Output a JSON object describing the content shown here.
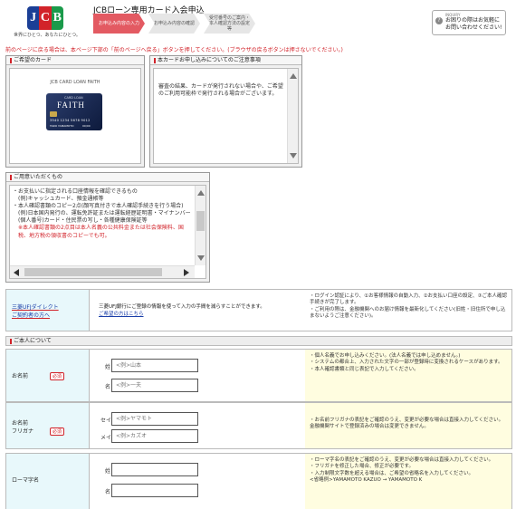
{
  "header": {
    "logo_letters": [
      "J",
      "C",
      "B"
    ],
    "tagline": "世界にひとつ、あなたにひとつ。",
    "title": "JCBローン専用カード入会申込",
    "steps": [
      {
        "label": "お申込み内容の入力",
        "active": true
      },
      {
        "label": "お申込み内容の確認",
        "active": false
      },
      {
        "label": "受付番号のご案内・本人確認方法の設定等",
        "active": false
      }
    ],
    "inquiry": {
      "small": "INQUIRY",
      "text": "お困りの際はお気軽にお問い合わせください!"
    }
  },
  "notice": "前のページに戻る場合は、本ページ下部の「前のページへ戻る」ボタンを押してください。(ブラウザの戻るボタンは押さないでください。)",
  "card_panel": {
    "title": "ご希望のカード",
    "card_name": "JCB CARD LOAN FAITH",
    "card_face": {
      "top": "CARD LOAN",
      "brand": "FAITH",
      "number": "3540 1234 5678 9012",
      "holder": "TARO YAMAMOTO",
      "expiry": "00/00"
    }
  },
  "notes_panel": {
    "title": "本カードお申し込みについてのご注意事項",
    "text": "審査の結果、カードが発行されない場合や、ご希望のご利用可能枠で発行される場合がございます。"
  },
  "prepare_panel": {
    "title": "ご用意いただくもの",
    "items": [
      "・お支払いに指定される口座情報を確認できるもの",
      "(例)キャッシュカード、預金通帳等",
      "・本人確認書類のコピー2点(顔写真付きで本人確認手続きを行う場合)",
      "(例)日本国内発行の、運転免許証または運転経歴証明書・マイナンバー(個人番号)カード・住民票の写し・各種健康保険証等"
    ],
    "red_note": "※本人確認書類の2点目は本人名義の公共料金または社会保険料、国税、地方税の領収書のコピーでも可。"
  },
  "direct_row": {
    "label_line1": "三菱UFJダイレクト",
    "label_line2": "ご契約者の方へ",
    "mid_text": "三菱UFJ銀行にご登録の情報を使って入力の手間を減らすことができます。",
    "mid_link": "ご希望の方はこちら",
    "right": [
      "・ログイン認証により、①お客様情報の自動入力、②お支払い口座の設定、③ご本人確認手続きが完了します。",
      "・ご利用の際は、金融機関へのお届け情報を最新化してください(旧姓・旧住所で申し込まないようご注意ください)。"
    ]
  },
  "section_title": "ご本人について",
  "required_label": "必須",
  "name_row": {
    "label": "お名前",
    "sei_label": "姓",
    "mei_label": "名",
    "sei_placeholder": "<例>山本",
    "mei_placeholder": "<例>一夫",
    "right": [
      "・個人名義でお申し込みください。(法人名義では申し込めません。)",
      "・システムの都合上、入力された文字の一部が登録時に変換されるケースがあります。",
      "・本人確認書類と同じ表記で入力してください。"
    ]
  },
  "kana_row": {
    "label_line1": "お名前",
    "label_line2": "フリガナ",
    "sei_label": "セイ",
    "mei_label": "メイ",
    "sei_placeholder": "<例>ヤマモト",
    "mei_placeholder": "<例>カズオ",
    "right": [
      "・お名前フリガナの表記をご確認のうえ、変更が必要な場合は直接入力してください。金融機関サイトで登録済みの場合は変更できません。"
    ]
  },
  "roman_row": {
    "label": "ローマ字名",
    "sei_label": "姓",
    "mei_label": "名",
    "sei_placeholder": "",
    "mei_placeholder": "",
    "right": [
      "・ローマ字名の表記をご確認のうえ、変更が必要な場合は直接入力してください。",
      "・フリガナを修正した場合、修正が必要です。",
      "・入力制限文字数を超える場合は、ご希望の省略名を入力してください。"
    ],
    "example": "<省略例>YAMAMOTO KAZUO → YAMAMOTO K"
  },
  "colors": {
    "accent_red": "#d2232a",
    "label_bg": "#e8f8fb",
    "help_bg": "#fffde0",
    "jcb_blue": "#1b3f96",
    "jcb_green": "#1a9a4a"
  }
}
